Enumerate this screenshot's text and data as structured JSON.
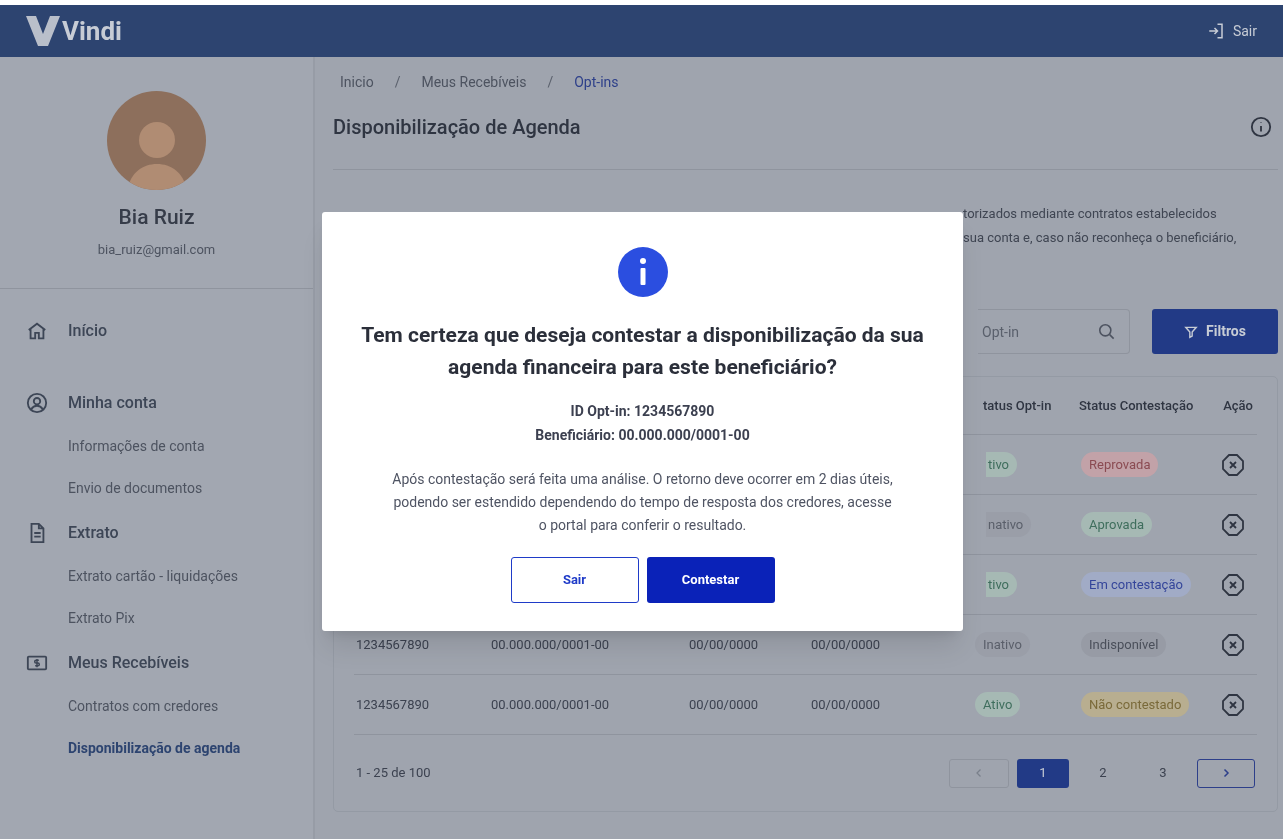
{
  "header": {
    "logo": "Vindi",
    "logout": "Sair"
  },
  "profile": {
    "name": "Bia Ruiz",
    "email": "bia_ruiz@gmail.com"
  },
  "nav": [
    {
      "label": "Início",
      "kind": "home"
    },
    {
      "label": "Minha conta",
      "kind": "account",
      "children": [
        {
          "label": "Informações de conta",
          "selected": false
        },
        {
          "label": "Envio de documentos",
          "selected": false
        }
      ]
    },
    {
      "label": "Extrato",
      "kind": "statement",
      "children": [
        {
          "label": "Extrato cartão - liquidações",
          "selected": false
        },
        {
          "label": "Extrato Pix",
          "selected": false
        }
      ]
    },
    {
      "label": "Meus Recebíveis",
      "kind": "receivables",
      "children": [
        {
          "label": "Contratos com credores",
          "selected": false
        },
        {
          "label": "Disponibilização de agenda",
          "selected": true
        }
      ]
    }
  ],
  "breadcrumb_separator": "/",
  "breadcrumb": [
    {
      "label": "Inicio",
      "current": false
    },
    {
      "label": "Meus Recebíveis",
      "current": false
    },
    {
      "label": "Opt-ins",
      "current": true
    }
  ],
  "page_title": "Disponibilização de Agenda",
  "description_fragments": [
    "torizados mediante contratos estabelecidos",
    "sua conta e, caso não reconheça o beneficiário,"
  ],
  "search": {
    "placeholder": "Opt-in"
  },
  "filter_button": "Filtros",
  "table": {
    "columns": [
      "tatus Opt-in",
      "Status Contestação",
      "Ação"
    ],
    "rows": [
      {
        "status_optin": {
          "label": "tivo",
          "color": "#a6b9b4"
        },
        "status_contestacao": {
          "label": "Reprovada",
          "color": "#c2a2a8"
        }
      },
      {
        "status_optin": {
          "label": "nativo",
          "color": "#9a9ea8"
        },
        "status_contestacao": {
          "label": "Aprovada",
          "color": "#a6b9b4"
        }
      },
      {
        "status_optin": {
          "label": "tivo",
          "color": "#a6b9b4"
        },
        "status_contestacao": {
          "label": "Em contestação",
          "color": "#a1abc6"
        }
      },
      {
        "id": "1234567890",
        "beneficiario": "00.000.000/0001-00",
        "date_1": "00/00/0000",
        "date_2": "00/00/0000",
        "status_optin": {
          "label": "Inativo",
          "color": "#9a9ea8"
        },
        "status_contestacao": {
          "label": "Indisponível",
          "color": "#979ba5"
        }
      },
      {
        "id": "1234567890",
        "beneficiario": "00.000.000/0001-00",
        "date_1": "00/00/0000",
        "date_2": "00/00/0000",
        "status_optin": {
          "label": "Ativo",
          "color": "#a6b9b4"
        },
        "status_contestacao": {
          "label": "Não contestado",
          "color": "#b8ae90"
        }
      }
    ]
  },
  "pagination": {
    "range": "1 - 25 de 100",
    "pages": [
      {
        "label": "1",
        "selected": true
      },
      {
        "label": "2",
        "selected": false
      },
      {
        "label": "3",
        "selected": false
      }
    ]
  },
  "modal": {
    "title": "Tem certeza que deseja contestar a disponibilização da sua agenda financeira para este beneficiário?",
    "id_line": "ID Opt-in: 1234567890",
    "beneficiary_line": "Beneficiário: 00.000.000/0001-00",
    "body": "Após contestação será feita uma análise. O retorno deve ocorrer em 2 dias úteis, podendo ser estendido dependendo do tempo de resposta dos credores, acesse o portal para conferir o resultado.",
    "buttons": [
      {
        "label": "Sair",
        "kind": "secondary"
      },
      {
        "label": "Contestar",
        "kind": "primary"
      }
    ]
  }
}
